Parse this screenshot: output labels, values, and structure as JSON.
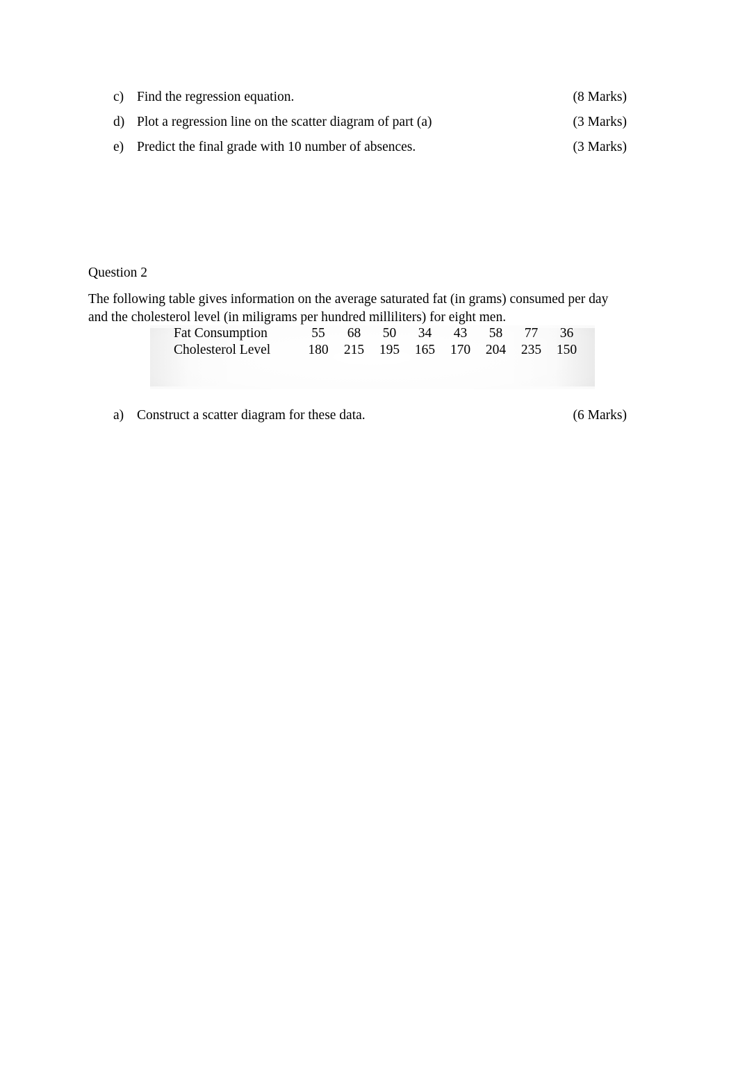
{
  "document": {
    "background_color": "#ffffff",
    "text_color": "#000000"
  },
  "question_1_parts": {
    "items": [
      {
        "marker": "c)",
        "text": "Find the regression equation.",
        "marks": "(8 Marks)"
      },
      {
        "marker": "d)",
        "text": "Plot a regression line on the scatter diagram of part (a)",
        "marks": "(3 Marks)"
      },
      {
        "marker": "e)",
        "text": "Predict the final grade with 10 number of absences.",
        "marks": "(3 Marks)"
      }
    ]
  },
  "question_2": {
    "heading": "Question 2",
    "intro_line_1": "The following table gives information on the average saturated fat (in grams) consumed per day",
    "intro_line_2": "and the cholesterol level (in miligrams per hundred milliliters) for eight men.",
    "table": {
      "rows": [
        {
          "label": "Fat Consumption",
          "values": [
            "55",
            "68",
            "50",
            "34",
            "43",
            "58",
            "77",
            "36"
          ]
        },
        {
          "label": "Cholesterol Level",
          "values": [
            "180",
            "215",
            "195",
            "165",
            "170",
            "204",
            "235",
            "150"
          ]
        }
      ]
    },
    "parts": [
      {
        "marker": "a)",
        "text": "Construct a scatter diagram for these data.",
        "marks": "(6 Marks)"
      }
    ]
  }
}
